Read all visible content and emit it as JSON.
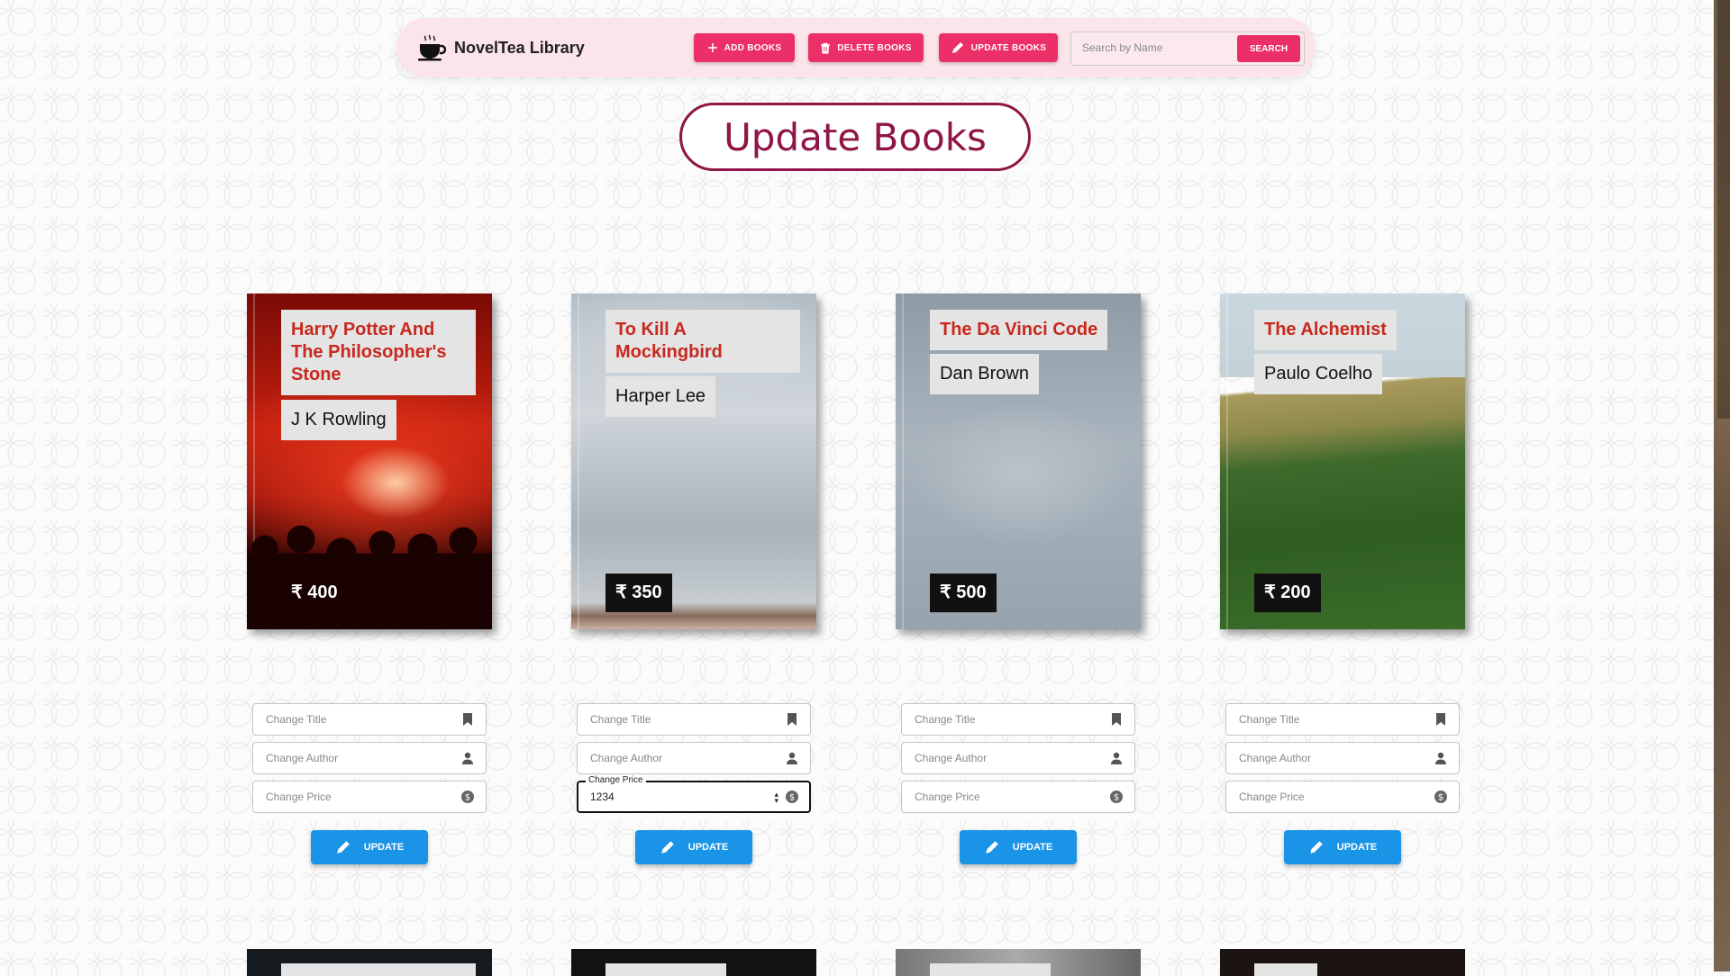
{
  "app": {
    "brand": "NovelTea Library",
    "nav": {
      "add_label": "ADD BOOKS",
      "delete_label": "DELETE BOOKS",
      "update_label": "UPDATE BOOKS"
    },
    "search": {
      "placeholder": "Search by Name",
      "value": "",
      "button_label": "SEARCH"
    },
    "accent_color": "#ec2f66",
    "update_button_color": "#1a94e6"
  },
  "page": {
    "title": "Update Books"
  },
  "books": [
    {
      "title": "Harry Potter And The Philosopher's Stone",
      "author": "J K Rowling",
      "price": "₹ 400"
    },
    {
      "title": "To Kill A Mockingbird",
      "author": "Harper Lee",
      "price": "₹ 350"
    },
    {
      "title": "The Da Vinci Code",
      "author": "Dan Brown",
      "price": "₹ 500"
    },
    {
      "title": "The Alchemist",
      "author": "Paulo Coelho",
      "price": "₹ 200"
    }
  ],
  "form": {
    "title_placeholder": "Change Title",
    "author_placeholder": "Change Author",
    "price_placeholder": "Change Price",
    "price_label": "Change Price",
    "button_label": "UPDATE",
    "active_price_value": "1234"
  }
}
